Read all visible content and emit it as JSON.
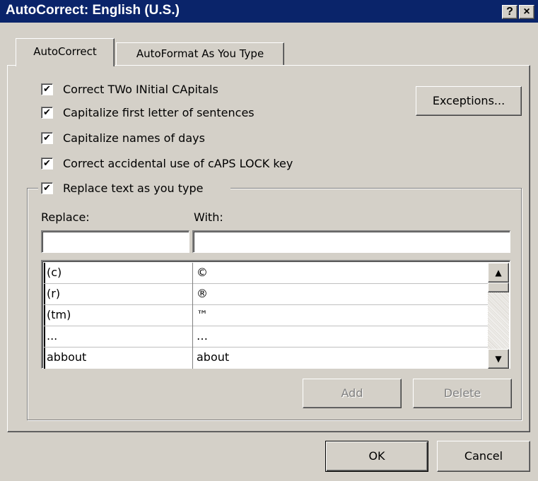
{
  "window": {
    "title": "AutoCorrect: English (U.S.)",
    "help_label": "?",
    "close_label": "×"
  },
  "tabs": [
    {
      "label": "AutoCorrect",
      "active": true
    },
    {
      "label": "AutoFormat As You Type",
      "active": false
    }
  ],
  "options": [
    {
      "label": "Correct TWo INitial CApitals",
      "checked": true
    },
    {
      "label": "Capitalize first letter of sentences",
      "checked": true
    },
    {
      "label": "Capitalize names of days",
      "checked": true
    },
    {
      "label": "Correct accidental use of cAPS LOCK key",
      "checked": true
    },
    {
      "label": "Replace text as you type",
      "checked": true
    }
  ],
  "exceptions_label": "Exceptions...",
  "replace": {
    "replace_label": "Replace:",
    "with_label": "With:",
    "replace_value": "",
    "with_value": ""
  },
  "entries": [
    {
      "replace": "(c)",
      "with": "©"
    },
    {
      "replace": "(r)",
      "with": "®"
    },
    {
      "replace": "(tm)",
      "with": "™"
    },
    {
      "replace": "...",
      "with": "…"
    },
    {
      "replace": "abbout",
      "with": "about"
    }
  ],
  "add_label": "Add",
  "delete_label": "Delete",
  "ok_label": "OK",
  "cancel_label": "Cancel",
  "scroll_up_glyph": "▲",
  "scroll_down_glyph": "▼",
  "check_glyph": "✔"
}
